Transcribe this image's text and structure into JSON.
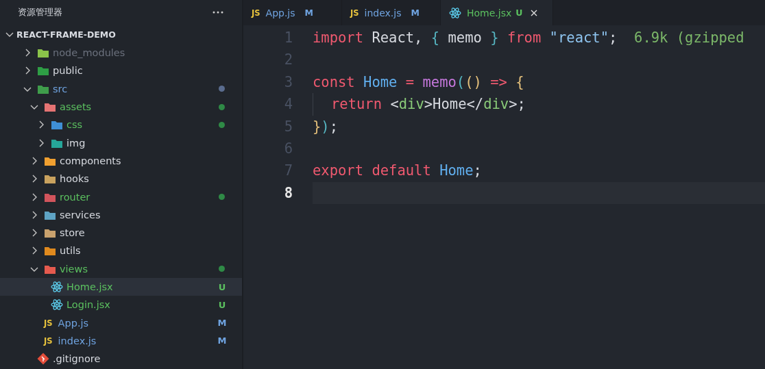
{
  "sidebar": {
    "title": "资源管理器",
    "root": {
      "name": "REACT-FRAME-DEMO",
      "expanded": true
    },
    "items": [
      {
        "name": "node_modules",
        "kind": "folder",
        "color": "#8bc34a",
        "expanded": false,
        "selected": false,
        "ignored": true,
        "modified": false,
        "untracked": false,
        "dot": false
      },
      {
        "name": "public",
        "kind": "folder",
        "color": "#2e9e45",
        "expanded": false,
        "selected": false,
        "ignored": false,
        "modified": false,
        "untracked": false,
        "dot": false
      },
      {
        "name": "src",
        "kind": "folder",
        "color": "#3f9d4b",
        "expanded": true,
        "selected": false,
        "ignored": false,
        "modified": true,
        "untracked": false,
        "dot": true,
        "children": [
          {
            "name": "assets",
            "kind": "folder",
            "color": "#e57373",
            "expanded": true,
            "selected": false,
            "ignored": false,
            "modified": false,
            "untracked": true,
            "dot": true,
            "children": [
              {
                "name": "css",
                "kind": "folder",
                "color": "#3f8fd6",
                "expanded": false,
                "selected": false,
                "ignored": false,
                "modified": false,
                "untracked": true,
                "dot": true
              },
              {
                "name": "img",
                "kind": "folder",
                "color": "#26a69a",
                "expanded": false,
                "selected": false,
                "ignored": false,
                "modified": false,
                "untracked": false,
                "dot": false
              }
            ]
          },
          {
            "name": "components",
            "kind": "folder",
            "color": "#f0a030",
            "expanded": false,
            "selected": false,
            "ignored": false,
            "modified": false,
            "untracked": false,
            "dot": false
          },
          {
            "name": "hooks",
            "kind": "folder",
            "color": "#c9a25e",
            "expanded": false,
            "selected": false,
            "ignored": false,
            "modified": false,
            "untracked": false,
            "dot": false
          },
          {
            "name": "router",
            "kind": "folder",
            "color": "#d2545c",
            "expanded": false,
            "selected": false,
            "ignored": false,
            "modified": false,
            "untracked": true,
            "dot": true
          },
          {
            "name": "services",
            "kind": "folder",
            "color": "#5ea3c4",
            "expanded": false,
            "selected": false,
            "ignored": false,
            "modified": false,
            "untracked": false,
            "dot": false
          },
          {
            "name": "store",
            "kind": "folder",
            "color": "#c9a26e",
            "expanded": false,
            "selected": false,
            "ignored": false,
            "modified": false,
            "untracked": false,
            "dot": false
          },
          {
            "name": "utils",
            "kind": "folder",
            "color": "#e08a1e",
            "expanded": false,
            "selected": false,
            "ignored": false,
            "modified": false,
            "untracked": false,
            "dot": false
          },
          {
            "name": "views",
            "kind": "folder",
            "color": "#e55a4e",
            "expanded": true,
            "selected": false,
            "ignored": false,
            "modified": false,
            "untracked": true,
            "dot": true,
            "children": [
              {
                "name": "Home.jsx",
                "kind": "react",
                "selected": true,
                "ignored": false,
                "modified": false,
                "untracked": true,
                "dot": false,
                "badge": "U"
              },
              {
                "name": "Login.jsx",
                "kind": "react",
                "selected": false,
                "ignored": false,
                "modified": false,
                "untracked": true,
                "dot": false,
                "badge": "U"
              }
            ]
          },
          {
            "name": "App.js",
            "kind": "js",
            "label": "JS",
            "selected": false,
            "ignored": false,
            "modified": true,
            "untracked": false,
            "dot": false,
            "badge": "M"
          },
          {
            "name": "index.js",
            "kind": "js",
            "label": "JS",
            "selected": false,
            "ignored": false,
            "modified": true,
            "untracked": false,
            "dot": false,
            "badge": "M"
          }
        ]
      },
      {
        "name": ".gitignore",
        "kind": "git",
        "selected": false,
        "ignored": false,
        "modified": false,
        "untracked": false,
        "dot": false
      }
    ]
  },
  "tabs": [
    {
      "label": "App.js",
      "kind": "js",
      "icon_text": "JS",
      "badge": "M",
      "modified": true,
      "untracked": false,
      "selected": false
    },
    {
      "label": "index.js",
      "kind": "js",
      "icon_text": "JS",
      "badge": "M",
      "modified": true,
      "untracked": false,
      "selected": false
    },
    {
      "label": "Home.jsx",
      "kind": "react",
      "badge": "U",
      "modified": false,
      "untracked": true,
      "selected": true
    }
  ],
  "editor": {
    "lines": [
      {
        "number": "1",
        "current": false,
        "tokens": [
          {
            "t": "import",
            "kind": "keyword"
          },
          {
            "t": " React, ",
            "kind": "plain"
          },
          {
            "t": "{",
            "kind": "brace2"
          },
          {
            "t": " memo ",
            "kind": "plain"
          },
          {
            "t": "}",
            "kind": "brace2"
          },
          {
            "t": " from",
            "kind": "keyword"
          },
          {
            "t": " \"react\"",
            "kind": "string"
          },
          {
            "t": ";",
            "kind": "plain"
          },
          {
            "t": "  6.9k (gzipped",
            "kind": "hint"
          }
        ]
      },
      {
        "number": "2",
        "current": false
      },
      {
        "number": "3",
        "current": false,
        "tokens": [
          {
            "t": "const",
            "kind": "keyword"
          },
          {
            "t": " Home",
            "kind": "var"
          },
          {
            "t": " =",
            "kind": "keyword"
          },
          {
            "t": " memo",
            "kind": "func"
          },
          {
            "t": "(",
            "kind": "brace2"
          },
          {
            "t": "()",
            "kind": "brace1"
          },
          {
            "t": " =>",
            "kind": "keyword"
          },
          {
            "t": " {",
            "kind": "brace1"
          }
        ]
      },
      {
        "number": "4",
        "current": false,
        "indent": true,
        "tokens": [
          {
            "t": "return",
            "kind": "keyword"
          },
          {
            "t": " <",
            "kind": "plain"
          },
          {
            "t": "div",
            "kind": "tag"
          },
          {
            "t": ">Home</",
            "kind": "plain"
          },
          {
            "t": "div",
            "kind": "tag"
          },
          {
            "t": ">;",
            "kind": "plain"
          }
        ]
      },
      {
        "number": "5",
        "current": false,
        "tokens": [
          {
            "t": "}",
            "kind": "brace1"
          },
          {
            "t": ")",
            "kind": "brace2"
          },
          {
            "t": ";",
            "kind": "plain"
          }
        ]
      },
      {
        "number": "6",
        "current": false
      },
      {
        "number": "7",
        "current": false,
        "tokens": [
          {
            "t": "export",
            "kind": "keyword"
          },
          {
            "t": " default",
            "kind": "keyword"
          },
          {
            "t": " Home",
            "kind": "var"
          },
          {
            "t": ";",
            "kind": "plain"
          }
        ]
      },
      {
        "number": "8",
        "current": true
      }
    ]
  }
}
